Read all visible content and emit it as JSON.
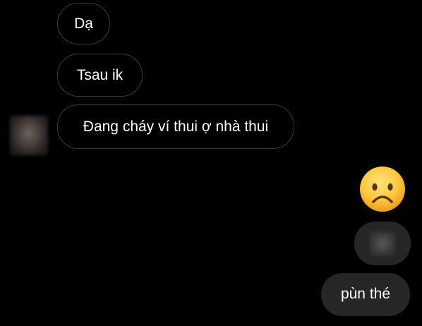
{
  "messages": {
    "incoming": [
      {
        "text": "Dạ"
      },
      {
        "text": "Tsau ik"
      },
      {
        "text": "Đang cháy ví thui ợ nhà thui"
      }
    ],
    "outgoing": [
      {
        "text": "pùn thé"
      }
    ]
  },
  "reaction": {
    "icon": "frowning-face-emoji"
  },
  "colors": {
    "background": "#000000",
    "incoming_bubble_border": "#3a3a3c",
    "outgoing_bubble": "#262626",
    "text": "#ffffff"
  }
}
